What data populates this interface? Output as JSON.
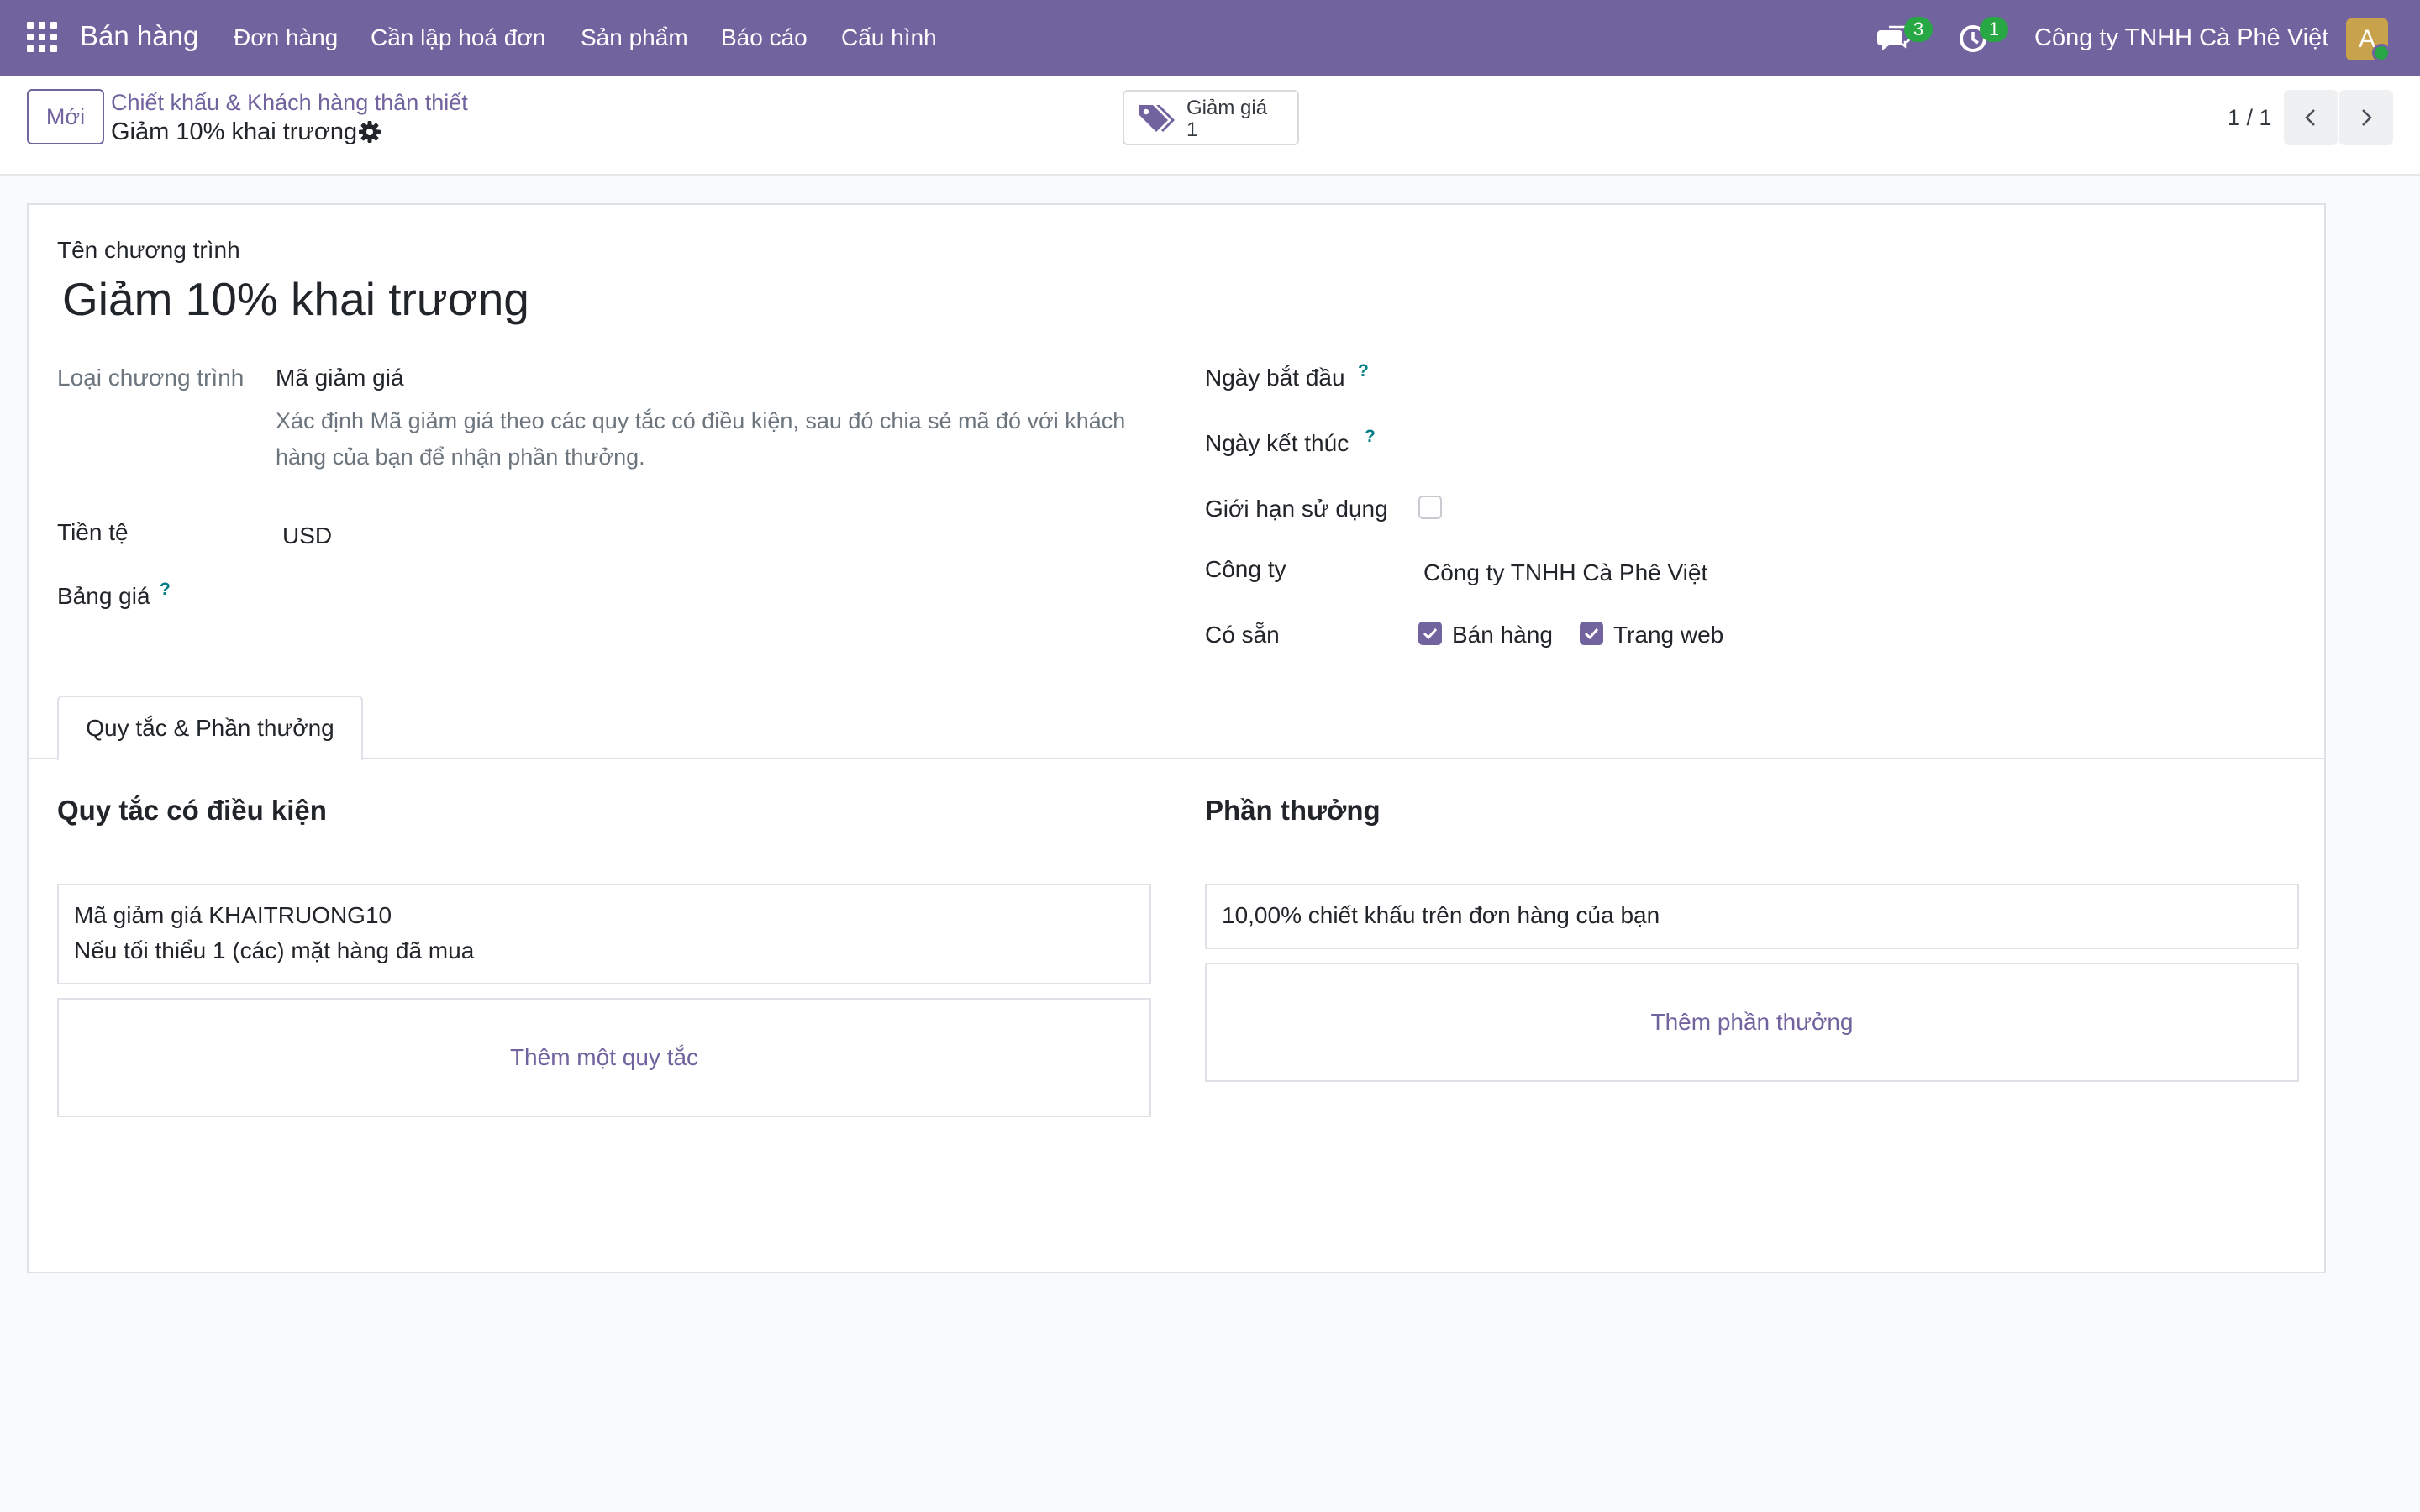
{
  "topbar": {
    "app_title": "Bán hàng",
    "menu": [
      "Đơn hàng",
      "Cần lập hoá đơn",
      "Sản phẩm",
      "Báo cáo",
      "Cấu hình"
    ],
    "messages_count": "3",
    "activities_count": "1",
    "company": "Công ty TNHH Cà Phê Việt",
    "avatar_letter": "A"
  },
  "control_panel": {
    "new_label": "Mới",
    "breadcrumb_parent": "Chiết khấu & Khách hàng thân thiết",
    "breadcrumb_current": "Giảm 10% khai trương",
    "smart_button": {
      "label": "Giảm giá",
      "count": "1"
    },
    "pager": "1 / 1"
  },
  "form": {
    "name_label": "Tên chương trình",
    "name_value": "Giảm 10% khai trương",
    "program_type_label": "Loại chương trình",
    "program_type_value": "Mã giảm giá",
    "program_type_desc": "Xác định Mã giảm giá theo các quy tắc có điều kiện, sau đó chia sẻ mã đó với khách hàng của bạn để nhận phần thưởng.",
    "currency_label": "Tiền tệ",
    "currency_value": "USD",
    "pricelist_label": "Bảng giá",
    "start_date_label": "Ngày bắt đầu",
    "end_date_label": "Ngày kết thúc",
    "usage_limit_label": "Giới hạn sử dụng",
    "company_label": "Công ty",
    "company_value": "Công ty TNHH Cà Phê Việt",
    "available_label": "Có sẵn",
    "available_sales": "Bán hàng",
    "available_website": "Trang web",
    "help_mark": "?",
    "tab_label": "Quy tắc & Phần thưởng",
    "rules_title": "Quy tắc có điều kiện",
    "rule_line1": "Mã giảm giá KHAITRUONG10",
    "rule_line2": "Nếu tối thiểu 1 (các) mặt hàng đã mua",
    "add_rule": "Thêm một quy tắc",
    "rewards_title": "Phần thưởng",
    "reward_line": "10,00% chiết khấu trên đơn hàng của bạn",
    "add_reward": "Thêm phần thưởng"
  },
  "colors": {
    "brand": "#71639e",
    "badge": "#28a745",
    "help": "#017e84"
  }
}
